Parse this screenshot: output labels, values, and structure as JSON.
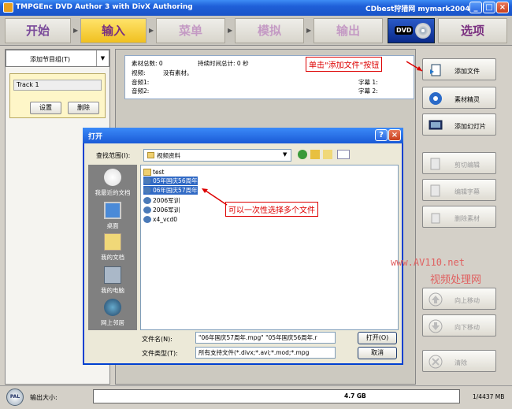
{
  "window": {
    "title": "TMPGEnc DVD Author 3 with DivX Authoring",
    "brand": "CDbest狩猎网 mymark2004",
    "controls": [
      "_",
      "□",
      "×"
    ]
  },
  "nav": {
    "tabs": [
      "开始",
      "输入",
      "菜单",
      "模拟",
      "输出",
      "选项"
    ],
    "dvd_label": "DVD"
  },
  "left": {
    "title_select": "添加节目组(T)",
    "track_name": "Track 1",
    "settings_button": "设置",
    "delete_button": "删除"
  },
  "info": {
    "clips_label": "素材总数: 0",
    "duration_label": "持续时间总计: 0 秒",
    "video_label": "视频:",
    "video_value": "没有素材。",
    "audio1": "音频1:",
    "audio2": "音频2:",
    "sub1": "字幕 1:",
    "sub2": "字幕 2:"
  },
  "right": {
    "add_file": "添加文件",
    "clip_wizard": "素材精灵",
    "add_slideshow": "添加幻灯片",
    "cut_edit": "剪切编辑",
    "edit_subtitle": "编辑字幕",
    "delete_clip": "删除素材",
    "move_up": "向上移动",
    "move_down": "向下移动",
    "clear": "清除"
  },
  "status": {
    "output_size_label": "输出大小:",
    "capacity": "4.7 GB",
    "used": "1/4437 MB",
    "pal": "PAL"
  },
  "dialog": {
    "title": "打开",
    "look_in_label": "查找范围(I):",
    "look_in_value": "视频资料",
    "places": [
      "我最近的文档",
      "桌面",
      "我的文档",
      "我的电脑",
      "网上邻居"
    ],
    "files": [
      {
        "name": "test",
        "type": "folder",
        "selected": false
      },
      {
        "name": "05年国庆56周年",
        "type": "video",
        "selected": true
      },
      {
        "name": "06年国庆57周年",
        "type": "video",
        "selected": true
      },
      {
        "name": "2006军训",
        "type": "video",
        "selected": false
      },
      {
        "name": "2006军训",
        "type": "video",
        "selected": false
      },
      {
        "name": "x4_vcd0",
        "type": "video",
        "selected": false
      }
    ],
    "filename_label": "文件名(N):",
    "filename_value": "\"06年国庆57周年.mpg\" \"05年国庆56周年.r",
    "filetype_label": "文件类型(T):",
    "filetype_value": "所有支持文件(*.divx;*.avi;*.mod;*.mpg",
    "open_button": "打开(O)",
    "cancel_button": "取消",
    "help": "?",
    "close": "×"
  },
  "annotations": {
    "add_file_hint": "单击\"添加文件\"按钮",
    "multi_select_hint": "可以一次性选择多个文件",
    "watermark_url": "www.AV110.net",
    "watermark_name": "视频处理网"
  },
  "colors": {
    "accent": "#1f5fd8",
    "active_tab": "#f0c020",
    "annotation": "#dd0000"
  }
}
